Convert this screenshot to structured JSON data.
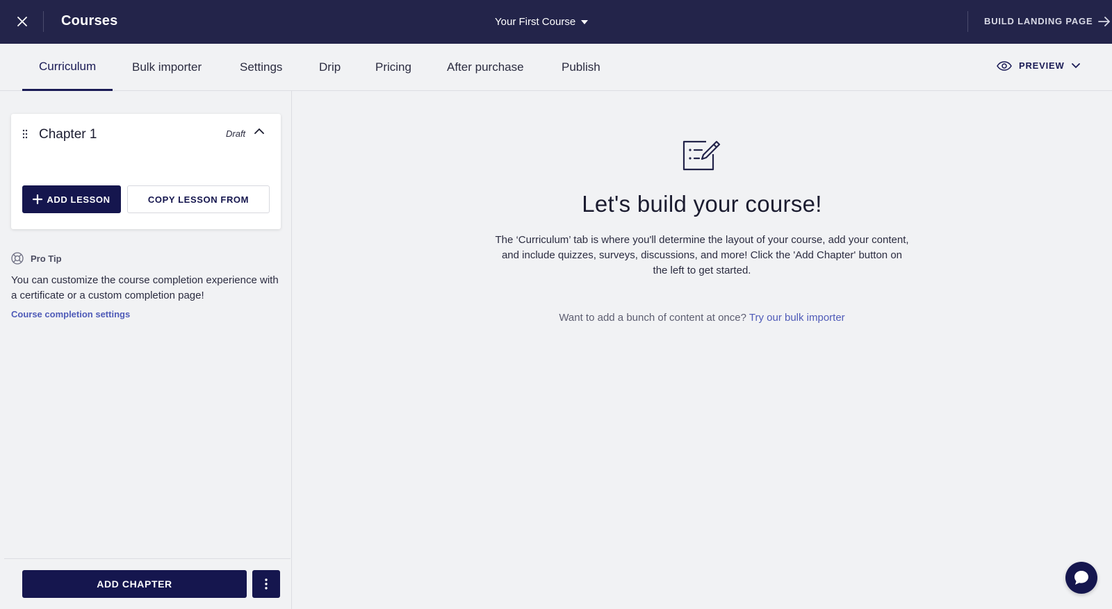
{
  "topbar": {
    "title": "Courses",
    "course_name": "Your First Course",
    "build_landing_label": "BUILD LANDING PAGE"
  },
  "tabs": [
    {
      "label": "Curriculum",
      "active": true
    },
    {
      "label": "Bulk importer",
      "active": false
    },
    {
      "label": "Settings",
      "active": false
    },
    {
      "label": "Drip",
      "active": false
    },
    {
      "label": "Pricing",
      "active": false
    },
    {
      "label": "After purchase",
      "active": false
    },
    {
      "label": "Publish",
      "active": false
    }
  ],
  "preview_label": "PREVIEW",
  "chapter": {
    "title": "Chapter 1",
    "status": "Draft",
    "add_lesson_label": "ADD LESSON",
    "copy_lesson_label": "COPY LESSON FROM"
  },
  "protip": {
    "heading": "Pro Tip",
    "text": "You can customize the course completion experience with a certificate or a custom completion page!",
    "link": "Course completion settings"
  },
  "footer": {
    "add_chapter_label": "ADD CHAPTER"
  },
  "empty_state": {
    "title": "Let's build your course!",
    "description": "The ‘Curriculum’ tab is where you'll determine the layout of your course, add your content, and include quizzes, surveys, discussions, and more! Click the 'Add Chapter' button on the left to get started.",
    "bulk_prompt": "Want to add a bunch of content at once?",
    "bulk_link": "Try our bulk importer"
  },
  "icons": {
    "close": "close-icon",
    "dropdown": "caret-down-icon",
    "arrow": "arrow-right-icon",
    "eye": "eye-icon",
    "drag": "drag-handle-icon",
    "chevron": "chevron-up-icon",
    "plus": "plus-icon",
    "lifebuoy": "lifebuoy-icon",
    "more": "more-vertical-icon",
    "edit_list": "edit-list-icon",
    "chat": "chat-icon"
  },
  "colors": {
    "topbar_bg": "#23244a",
    "primary": "#15164e",
    "link": "#4f5bb8",
    "page_bg": "#f1f2f4"
  }
}
